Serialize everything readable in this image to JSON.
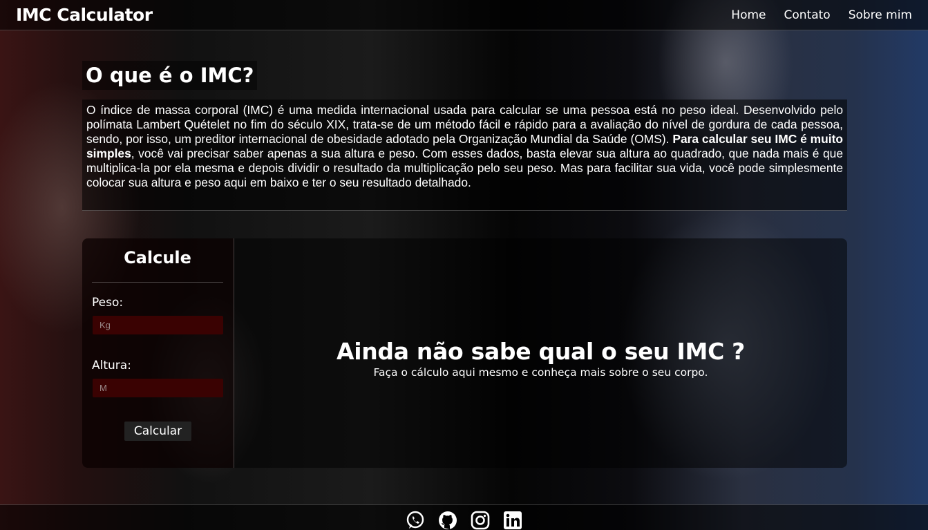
{
  "navbar": {
    "brand": "IMC Calculator",
    "links": [
      {
        "label": "Home"
      },
      {
        "label": "Contato"
      },
      {
        "label": "Sobre mim"
      }
    ]
  },
  "about": {
    "title": "O que é o IMC?",
    "text_before_bold": "O índice de massa corporal (IMC) é uma medida internacional usada para calcular se uma pessoa está no peso ideal. Desenvolvido pelo polímata Lambert Quételet no fim do século XIX, trata-se de um método fácil e rápido para a avaliação do nível de gordura de cada pessoa, sendo, por isso, um preditor internacional de obesidade adotado pela Organização Mundial da Saúde (OMS). ",
    "text_bold": "Para calcular seu IMC é muito simples",
    "text_after_bold": ", você vai precisar saber apenas a sua altura e peso. Com esses dados, basta elevar sua altura ao quadrado, que nada mais é que multiplica-la por ela mesma e depois dividir o resultado da multiplicação pelo seu peso. Mas para facilitar sua vida, você pode simplesmente colocar sua altura e peso aqui em baixo e ter o seu resultado detalhado."
  },
  "calc": {
    "title": "Calcule",
    "weight_label": "Peso:",
    "weight_placeholder": "Kg",
    "height_label": "Altura:",
    "height_placeholder": "M",
    "button_label": "Calcular"
  },
  "result": {
    "title": "Ainda não sabe qual o seu IMC ?",
    "subtitle": "Faça o cálculo aqui mesmo e conheça mais sobre o seu corpo."
  },
  "footer": {
    "icons": [
      "whatsapp-icon",
      "github-icon",
      "instagram-icon",
      "linkedin-icon"
    ]
  }
}
